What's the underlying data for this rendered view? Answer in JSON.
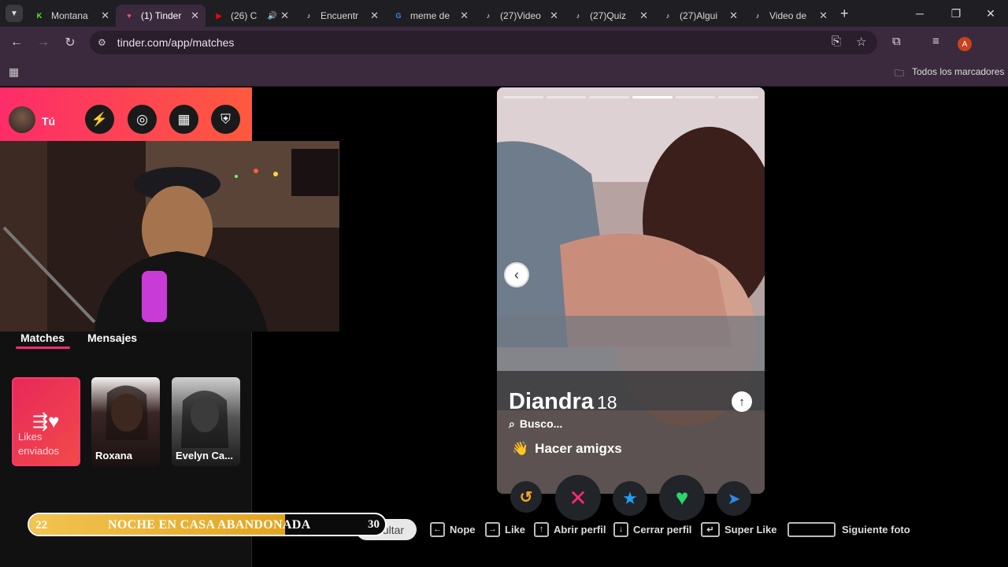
{
  "browser": {
    "tabs": [
      {
        "title": "Montana",
        "icon": "kick-icon",
        "color": "#53fc18",
        "glyph": "K"
      },
      {
        "title": "(1) Tinder",
        "icon": "tinder-icon",
        "color": "#fd5068",
        "glyph": "♥",
        "active": true
      },
      {
        "title": "(26) C",
        "icon": "youtube-icon",
        "color": "#ff0000",
        "glyph": "▶",
        "audio": true
      },
      {
        "title": "Encuentr",
        "icon": "tiktok-icon",
        "color": "#ffffff",
        "glyph": "♪"
      },
      {
        "title": "meme de",
        "icon": "google-icon",
        "color": "#4285f4",
        "glyph": "G"
      },
      {
        "title": "(27)Video",
        "icon": "tiktok-icon",
        "color": "#ffffff",
        "glyph": "♪"
      },
      {
        "title": "(27)Quiz",
        "icon": "tiktok-icon",
        "color": "#ffffff",
        "glyph": "♪"
      },
      {
        "title": "(27)Algui",
        "icon": "tiktok-icon",
        "color": "#ffffff",
        "glyph": "♪"
      },
      {
        "title": "Video de",
        "icon": "tiktok-icon",
        "color": "#ffffff",
        "glyph": "♪"
      }
    ],
    "url": "tinder.com/app/matches",
    "profile_initial": "A",
    "bookmarks_all_label": "Todos los marcadores"
  },
  "sidebar": {
    "me_label": "Tú",
    "tabs": {
      "matches": "Matches",
      "messages": "Mensajes"
    },
    "likes_card": {
      "label_line1": "Likes",
      "label_line2": "enviados"
    },
    "matches": [
      {
        "name": "Roxana"
      },
      {
        "name": "Evelyn Ca..."
      }
    ]
  },
  "profile": {
    "name": "Diandra",
    "age": "18",
    "looking_label": "Busco...",
    "looking_value": "Hacer amigxs",
    "looking_emoji": "👋",
    "photo_count": 6,
    "current_photo": 4
  },
  "hints": {
    "hide": "Ocultar",
    "nope": "Nope",
    "like": "Like",
    "open_profile": "Abrir perfil",
    "close_profile": "Cerrar perfil",
    "super_like": "Super Like",
    "next_photo": "Siguiente foto"
  },
  "overlay": {
    "left_number": "22",
    "title": "NOCHE EN CASA ABANDONADA",
    "right_number": "30",
    "progress_fraction": 0.72
  },
  "colors": {
    "tinder_gradient_start": "#fd2c6a",
    "tinder_gradient_end": "#fe5a3e",
    "rewind": "#f5a623",
    "nope": "#fd297b",
    "superlike": "#1ea0f7",
    "like": "#2ad66c",
    "boost": "#2b8cf0"
  }
}
